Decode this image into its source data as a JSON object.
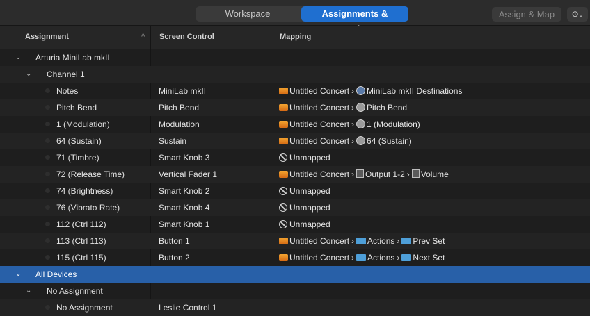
{
  "toolbar": {
    "tabs": [
      {
        "label": "Workspace",
        "active": false
      },
      {
        "label": "Assignments & Mappings",
        "active": true
      }
    ],
    "assign_map_label": "Assign & Map",
    "more_icon": "ellipsis-circle-icon",
    "chevron_icon": "chevron-down-icon"
  },
  "columns": {
    "assignment": "Assignment",
    "screen_control": "Screen Control",
    "mapping": "Mapping"
  },
  "rows": [
    {
      "level": 0,
      "label": "Arturia MiniLab mkII",
      "control": "",
      "mapping": []
    },
    {
      "level": 1,
      "label": "Channel 1",
      "control": "",
      "mapping": []
    },
    {
      "level": 2,
      "label": "Notes",
      "control": "MiniLab mkII",
      "mapping": [
        {
          "icon": "concert-icon",
          "text": "Untitled Concert"
        },
        {
          "icon": "keyboard-knob-icon",
          "text": "MiniLab mkII Destinations"
        }
      ]
    },
    {
      "level": 2,
      "label": "Pitch Bend",
      "control": "Pitch Bend",
      "mapping": [
        {
          "icon": "concert-icon",
          "text": "Untitled Concert"
        },
        {
          "icon": "knob-icon",
          "text": "Pitch Bend"
        }
      ]
    },
    {
      "level": 2,
      "label": "1 (Modulation)",
      "control": "Modulation",
      "mapping": [
        {
          "icon": "concert-icon",
          "text": "Untitled Concert"
        },
        {
          "icon": "knob-icon",
          "text": "1 (Modulation)"
        }
      ]
    },
    {
      "level": 2,
      "label": "64 (Sustain)",
      "control": "Sustain",
      "mapping": [
        {
          "icon": "concert-icon",
          "text": "Untitled Concert"
        },
        {
          "icon": "knob-icon",
          "text": "64 (Sustain)"
        }
      ]
    },
    {
      "level": 2,
      "label": "71 (Timbre)",
      "control": "Smart Knob 3",
      "mapping": [
        {
          "icon": "unmapped-icon",
          "text": "Unmapped"
        }
      ]
    },
    {
      "level": 2,
      "label": "72 (Release Time)",
      "control": "Vertical Fader 1",
      "mapping": [
        {
          "icon": "concert-icon",
          "text": "Untitled Concert"
        },
        {
          "icon": "channel-strip-icon",
          "text": "Output 1-2"
        },
        {
          "icon": "channel-strip-icon",
          "text": "Volume"
        }
      ]
    },
    {
      "level": 2,
      "label": "74 (Brightness)",
      "control": "Smart Knob 2",
      "mapping": [
        {
          "icon": "unmapped-icon",
          "text": "Unmapped"
        }
      ]
    },
    {
      "level": 2,
      "label": "76 (Vibrato Rate)",
      "control": "Smart Knob 4",
      "mapping": [
        {
          "icon": "unmapped-icon",
          "text": "Unmapped"
        }
      ]
    },
    {
      "level": 2,
      "label": "112 (Ctrl 112)",
      "control": "Smart Knob 1",
      "mapping": [
        {
          "icon": "unmapped-icon",
          "text": "Unmapped"
        }
      ]
    },
    {
      "level": 2,
      "label": "113 (Ctrl 113)",
      "control": "Button 1",
      "mapping": [
        {
          "icon": "concert-icon",
          "text": "Untitled Concert"
        },
        {
          "icon": "folder-icon",
          "text": "Actions"
        },
        {
          "icon": "folder-icon",
          "text": "Prev Set"
        }
      ]
    },
    {
      "level": 2,
      "label": "115 (Ctrl 115)",
      "control": "Button 2",
      "mapping": [
        {
          "icon": "concert-icon",
          "text": "Untitled Concert"
        },
        {
          "icon": "folder-icon",
          "text": "Actions"
        },
        {
          "icon": "folder-icon",
          "text": "Next Set"
        }
      ]
    },
    {
      "level": 0,
      "label": "All Devices",
      "control": "",
      "mapping": [],
      "selected": true
    },
    {
      "level": 1,
      "label": "No Assignment",
      "control": "",
      "mapping": []
    },
    {
      "level": 2,
      "label": "No Assignment",
      "control": "Leslie Control 1",
      "mapping": []
    }
  ],
  "colors": {
    "accent": "#1f6fd0",
    "selected_row": "#2860a8",
    "background": "#1e1e1e",
    "concert_icon": "#f3a430",
    "folder_icon": "#4e9fd8"
  }
}
